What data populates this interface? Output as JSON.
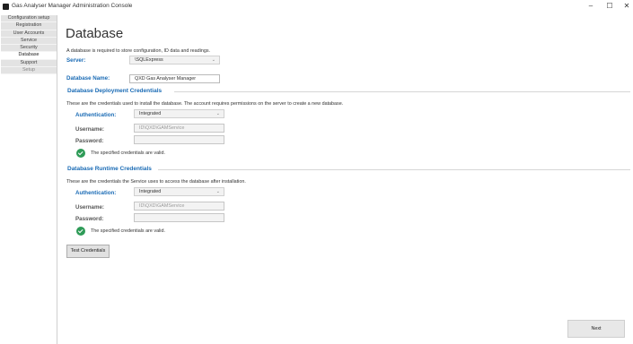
{
  "window": {
    "title": "Gas Analyser Manager Administration Console",
    "minimize": "‒",
    "maximize": "☐",
    "close": "✕"
  },
  "sidebar": {
    "items": [
      {
        "label": "Configuration setup"
      },
      {
        "label": "Registration"
      },
      {
        "label": "User Accounts"
      },
      {
        "label": "Service"
      },
      {
        "label": "Security"
      },
      {
        "label": "Database"
      },
      {
        "label": "Support"
      },
      {
        "label": "Setup"
      }
    ]
  },
  "main": {
    "title": "Database",
    "description": "A database is required to store configuration, ID data and readings.",
    "server_label": "Server:",
    "server_value": "\\SQLExpress",
    "dbname_label": "Database Name:",
    "dbname_value": "QXD Gas Analyser Manager"
  },
  "deployment": {
    "header": "Database Deployment Credentials",
    "description": "These are the credentials used to install the database. The account requires permissions on the server to create a new database.",
    "auth_label": "Authentication:",
    "auth_value": "Integrated",
    "username_label": "Username:",
    "username_value": "ID\\QXD\\GAMService",
    "password_label": "Password:",
    "password_value": "",
    "valid_text": "The specified credentials are valid."
  },
  "runtime": {
    "header": "Database Runtime Credentials",
    "description": "These are the credentials the Service uses to access the database after installation.",
    "auth_label": "Authentication:",
    "auth_value": "Integrated",
    "username_label": "Username:",
    "username_value": "ID\\QXD\\GAMService",
    "password_label": "Password:",
    "password_value": "",
    "valid_text": "The specified credentials are valid."
  },
  "buttons": {
    "test_credentials": "Test Credentials",
    "next": "Next"
  },
  "icons": {
    "app": "app-icon",
    "check": "check-circle-icon",
    "dropdown": "chevron-down-icon"
  },
  "colors": {
    "accent": "#1a6bb5",
    "success": "#2e9b57"
  }
}
